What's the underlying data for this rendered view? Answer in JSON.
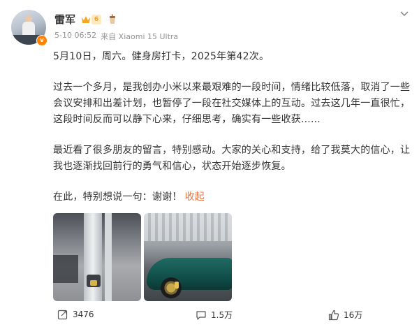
{
  "post": {
    "author": {
      "name": "雷军",
      "vip_level": "6",
      "avatar_badge": "v"
    },
    "meta": {
      "timestamp": "5-10 06:52",
      "source": "来自 Xiaomi 15 Ultra"
    },
    "content": {
      "line1": "5月10日，周六。健身房打卡，2025年第42次。",
      "para2": "过去一个多月，是我创办小米以来最艰难的一段时间，情绪比较低落，取消了一些会议安排和出差计划，也暂停了一段在社交媒体上的互动。过去这几年一直很忙，这段时间反而可以静下心来，仔细思考，确实有一些收获......",
      "para3": "最近看了很多朋友的留言，特别感动。大家的关心和支持，给了我莫大的信心，让我也逐渐找回前行的勇气和信心，状态开始逐步恢复。",
      "para4": "在此，特别想说一句：谢谢！",
      "collapse_label": "收起"
    },
    "images": [
      {
        "name": "gym-photo"
      },
      {
        "name": "car-photo"
      }
    ],
    "actions": {
      "share_count": "3476",
      "comment_count": "1.5万",
      "like_count": "16万"
    },
    "colors": {
      "accent": "#eb7340",
      "text": "#333333",
      "meta": "#939393",
      "badge": "#ff8200"
    },
    "icons": {
      "share": "share-icon",
      "comment": "comment-icon",
      "like": "like-icon",
      "more": "chevron-down-icon",
      "crown": "crown-icon",
      "cup": "cup-icon"
    }
  }
}
